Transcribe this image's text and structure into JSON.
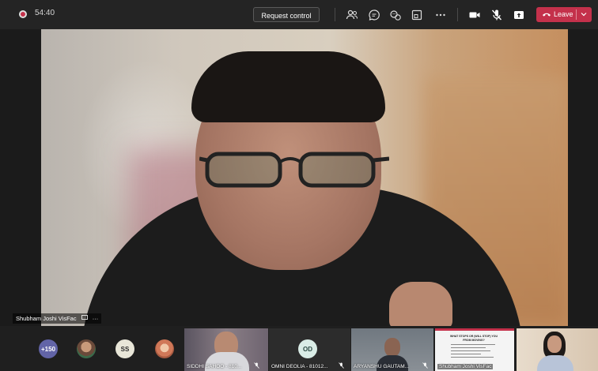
{
  "meeting": {
    "timer": "54:40",
    "request_control_label": "Request control",
    "leave_label": "Leave"
  },
  "colors": {
    "leave": "#c4314b",
    "bar": "#242424",
    "avatar_purple": "#6264a7"
  },
  "toolbar_icons": [
    "participants-icon",
    "chat-icon",
    "reactions-icon",
    "rooms-icon",
    "more-icon",
    "camera-icon",
    "mic-muted-icon",
    "share-icon"
  ],
  "main_video": {
    "name": "Shubham Joshi VisFac"
  },
  "participants": {
    "overflow_count": "+150",
    "ss_initials": "SS",
    "od_initials": "OD",
    "tiles": [
      {
        "name": "SIDDHI SAHOO - 810..."
      },
      {
        "name": "OMNI DEOLIA - 81012..."
      },
      {
        "name": "ARYANSHU GAUTAM..."
      },
      {
        "name": "Shubham Joshi VisFac"
      }
    ],
    "slide": {
      "title": "WHAT STOPS OR (WILL STOP) YOU FROM MOVING?"
    }
  }
}
